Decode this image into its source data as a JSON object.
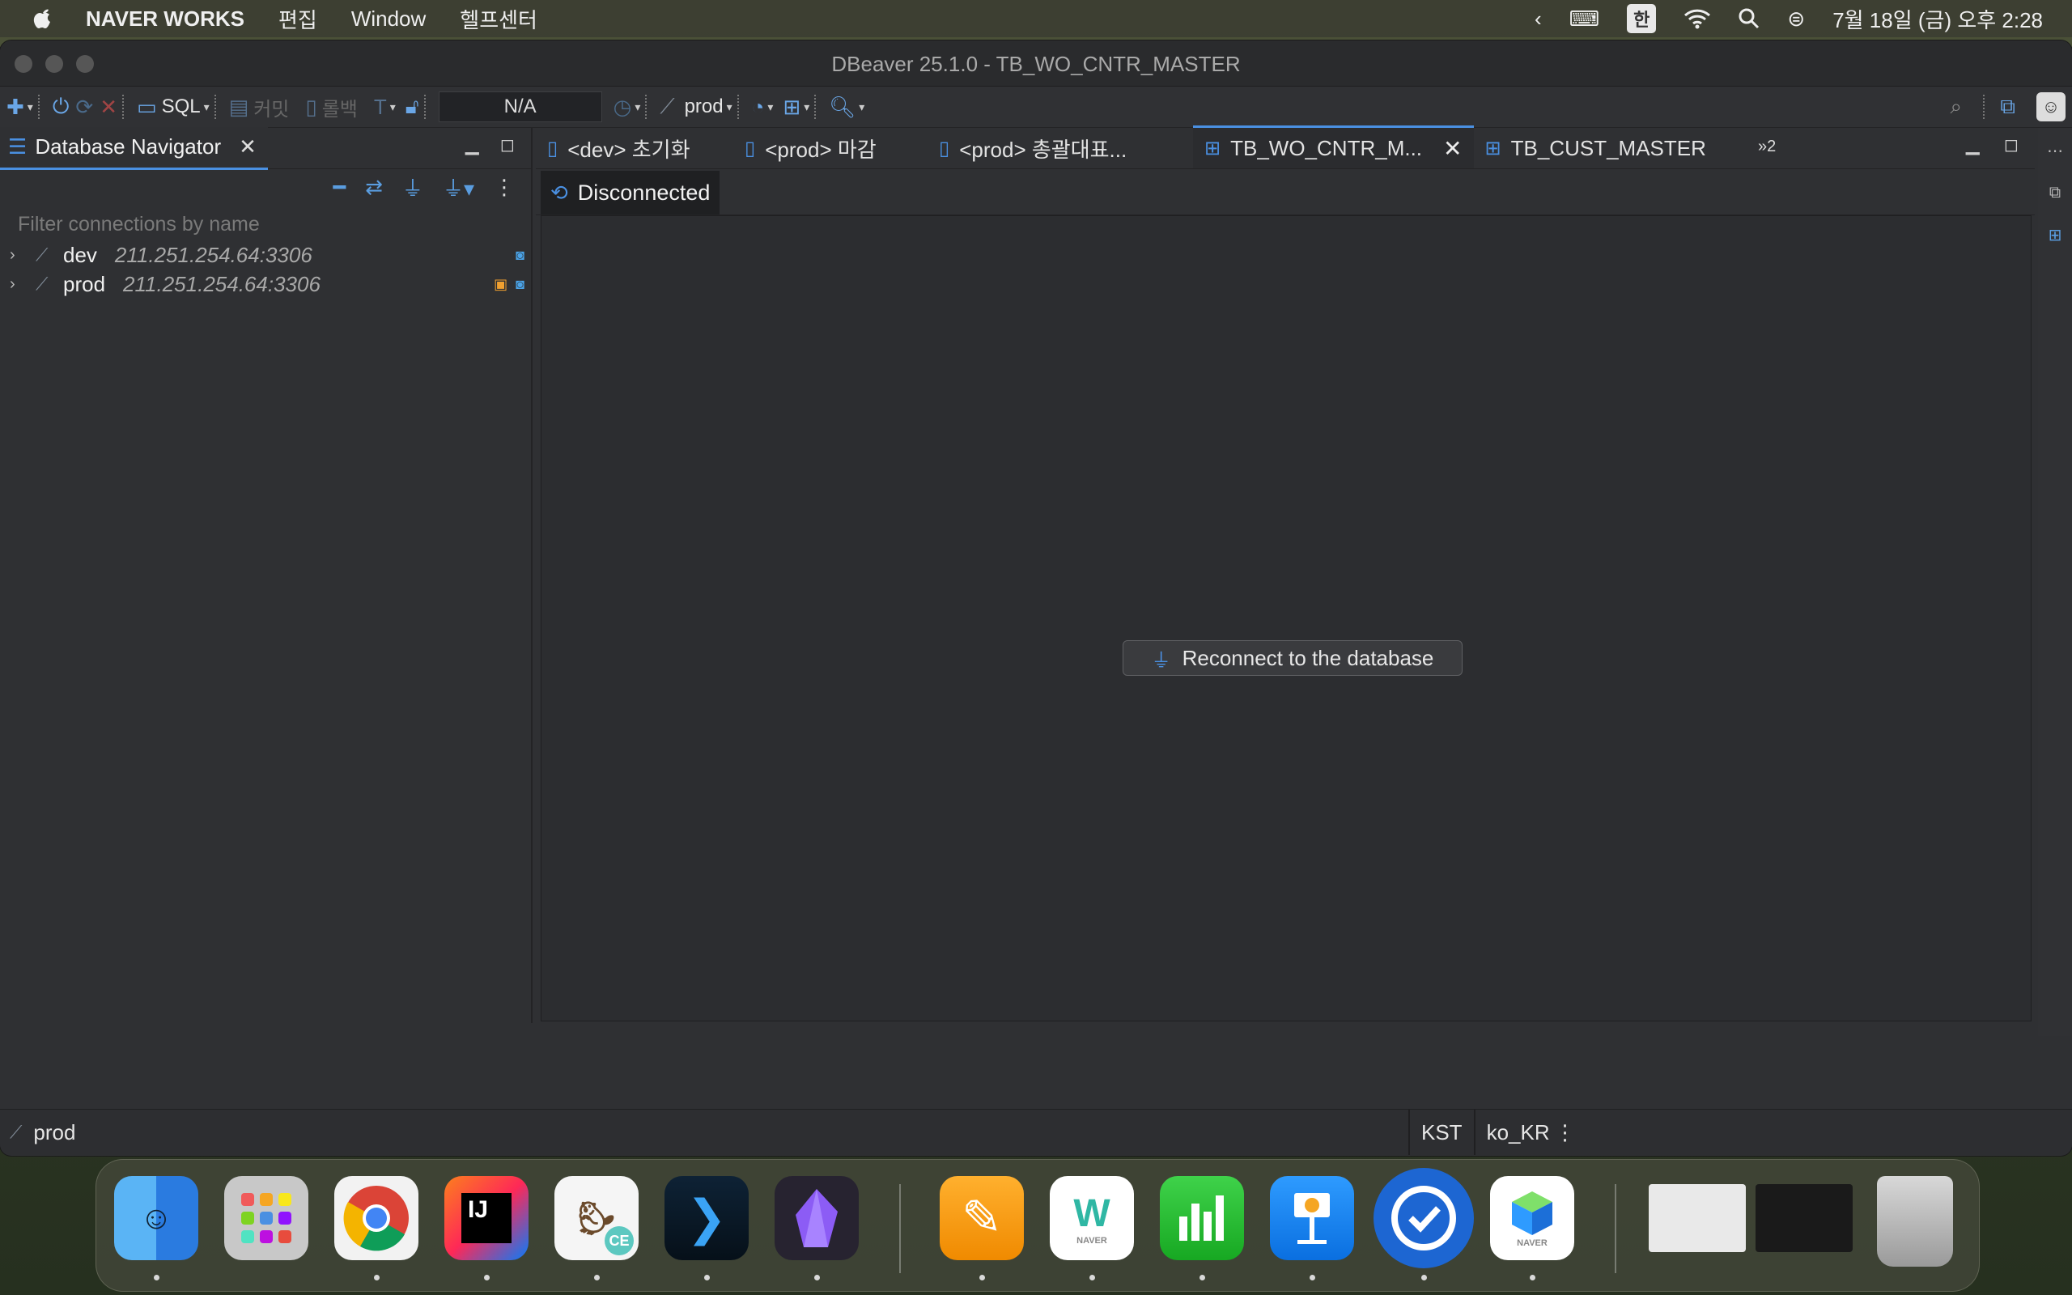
{
  "menubar": {
    "app_name": "NAVER WORKS",
    "items": [
      "편집",
      "Window",
      "헬프센터"
    ],
    "input_mode": "한",
    "clock": "7월 18일 (금) 오후 2:28"
  },
  "window": {
    "title": "DBeaver 25.1.0 - TB_WO_CNTR_MASTER"
  },
  "toolbar": {
    "sql_label": "SQL",
    "commit_label": "커밋",
    "rollback_label": "롤백",
    "schema_value": "N/A",
    "datasource_label": "prod"
  },
  "navigator": {
    "tab_label": "Database Navigator",
    "filter_placeholder": "Filter connections by name",
    "connections": [
      {
        "name": "dev",
        "host": "211.251.254.64:3306"
      },
      {
        "name": "prod",
        "host": "211.251.254.64:3306"
      }
    ]
  },
  "editor": {
    "tabs": [
      {
        "label": "<dev> 초기화"
      },
      {
        "label": "<prod> 마감"
      },
      {
        "label": "<prod> 총괄대표..."
      },
      {
        "label": "TB_WO_CNTR_M..."
      },
      {
        "label": "TB_CUST_MASTER"
      }
    ],
    "more_tabs": "»2",
    "status_tab": "Disconnected",
    "reconnect_label": "Reconnect to the database"
  },
  "statusbar": {
    "connection": "prod",
    "timezone": "KST",
    "locale": "ko_KR"
  },
  "colors": {
    "accent": "#4a90e2",
    "lock": "#f0a030"
  },
  "dock": {
    "apps": [
      "finder-icon",
      "launchpad-icon",
      "chrome-icon",
      "intellij-icon",
      "dbeaver-icon",
      "terminal-icon",
      "obsidian-icon",
      "pages-icon",
      "naver-works-icon",
      "numbers-icon",
      "keynote-icon",
      "sync-icon",
      "naver-box-icon",
      "trash-icon"
    ],
    "naver_caption": "NAVER",
    "ij_label": "IJ",
    "ce_label": "CE",
    "w_label": "W"
  }
}
